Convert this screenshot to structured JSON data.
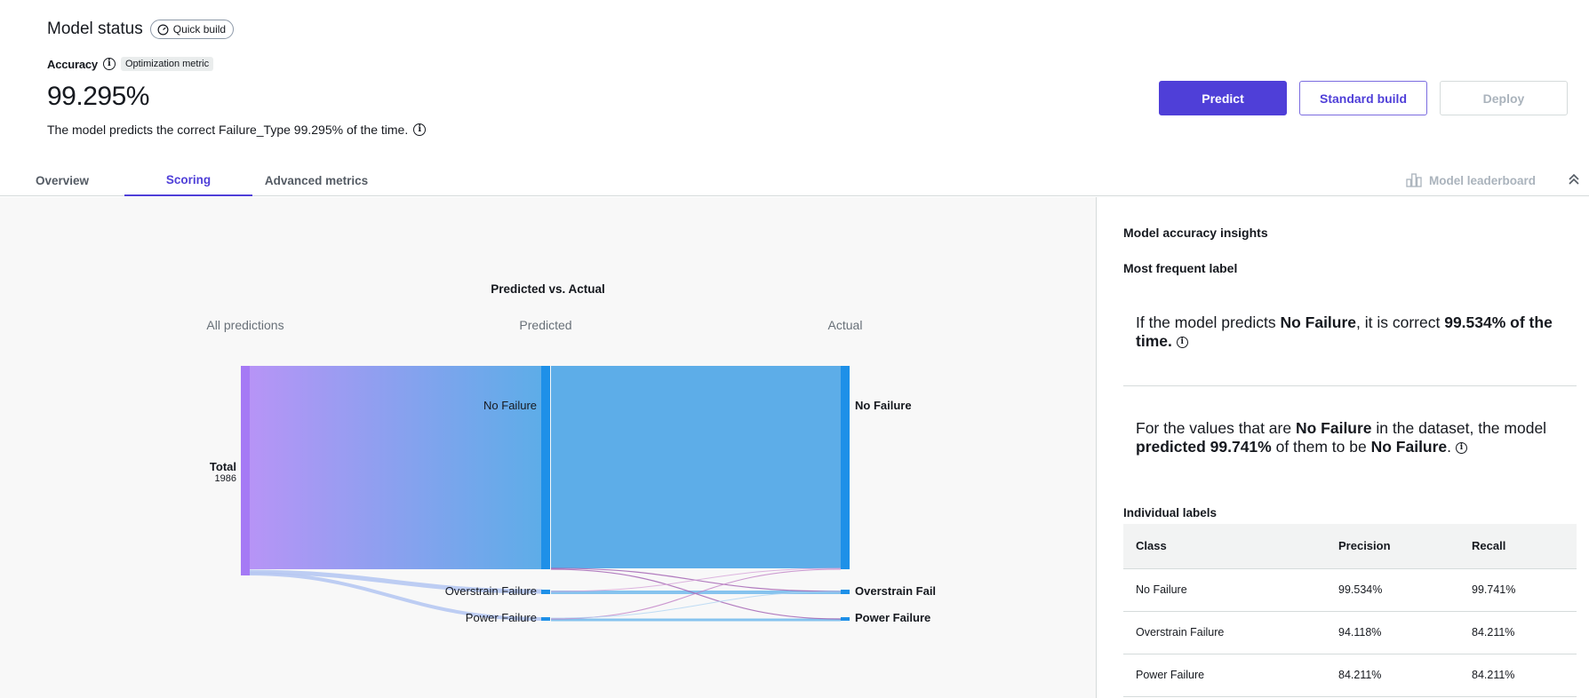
{
  "header": {
    "title": "Model status",
    "build_badge": "Quick build",
    "accuracy_label": "Accuracy",
    "optimization_tag": "Optimization metric",
    "accuracy_value": "99.295%",
    "accuracy_desc": "The model predicts the correct Failure_Type 99.295% of the time."
  },
  "actions": {
    "predict": "Predict",
    "standard_build": "Standard build",
    "deploy": "Deploy"
  },
  "tabs": {
    "overview": "Overview",
    "scoring": "Scoring",
    "advanced": "Advanced metrics",
    "leaderboard": "Model leaderboard",
    "active": "Scoring"
  },
  "chart": {
    "title": "Predicted vs. Actual",
    "col_all": "All predictions",
    "col_predicted": "Predicted",
    "col_actual": "Actual",
    "total_label": "Total",
    "total_value": "1986",
    "pred_no_failure": "No Failure",
    "pred_overstrain": "Overstrain Failure",
    "pred_power": "Power Failure",
    "act_no_failure": "No Failure",
    "act_overstrain": "Overstrain Fail",
    "act_power": "Power Failure"
  },
  "colors": {
    "accent": "#4f3fd8",
    "flow_start": "#b794f6",
    "flow_mid": "#5dade8",
    "node_total": "#a57af5",
    "node_pred": "#1e90e8",
    "wrong_flow": "#a05cb0"
  },
  "insights": {
    "title": "Model accuracy insights",
    "most_frequent": "Most frequent label",
    "p1_a": "If the model predicts ",
    "p1_b": "No Failure",
    "p1_c": ", it is correct ",
    "p1_d": "99.534% of the time.",
    "p2_a": "For the values that are ",
    "p2_b": "No Failure",
    "p2_c": " in the dataset, the model ",
    "p2_d": "predicted 99.741%",
    "p2_e": " of them to be ",
    "p2_f": "No Failure",
    "p2_g": ".",
    "individual": "Individual labels",
    "table": {
      "headers": [
        "Class",
        "Precision",
        "Recall"
      ],
      "rows": [
        [
          "No Failure",
          "99.534%",
          "99.741%"
        ],
        [
          "Overstrain Failure",
          "94.118%",
          "84.211%"
        ],
        [
          "Power Failure",
          "84.211%",
          "84.211%"
        ]
      ]
    }
  }
}
